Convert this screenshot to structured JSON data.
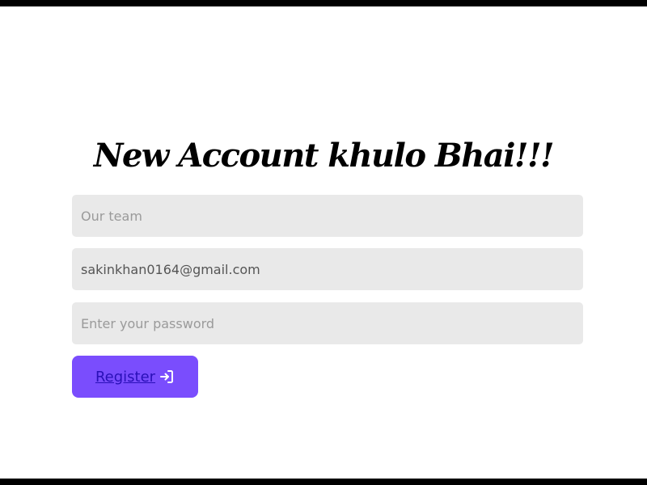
{
  "form": {
    "title": "New Account khulo Bhai!!!",
    "name_placeholder": "Our team",
    "email_value": "sakinkhan0164@gmail.com",
    "password_placeholder": "Enter your password",
    "register_label": "Register",
    "register_icon": "login-arrow-icon"
  },
  "colors": {
    "button_background": "#7a4dfd",
    "field_background": "#e9e9e9",
    "link_text": "#2a10b8"
  }
}
